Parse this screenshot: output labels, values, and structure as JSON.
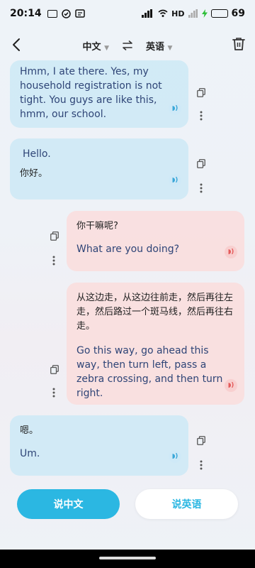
{
  "status_bar": {
    "time": "20:14",
    "right_text": "HD",
    "battery": "69",
    "battery_level": 0.69
  },
  "header": {
    "source_lang": "中文",
    "target_lang": "英语"
  },
  "messages": [
    {
      "side": "left",
      "en": "Hmm, I ate there. Yes, my household registration is not tight. You guys are like this, hmm, our school."
    },
    {
      "side": "left",
      "en": "Hello.",
      "zh": "你好。"
    },
    {
      "side": "right",
      "zh": "你干嘛呢?",
      "en": "What are you doing?"
    },
    {
      "side": "right",
      "zh": "从这边走，从这边往前走，然后再往左走，然后路过一个斑马线，然后再往右走。",
      "en": "Go this way, go ahead this way, then turn left, pass a zebra crossing, and then turn right."
    },
    {
      "side": "left",
      "zh": "嗯。",
      "en": "Um."
    }
  ],
  "buttons": {
    "speak_chinese": "说中文",
    "speak_english": "说英语"
  },
  "icons": {
    "back": "chevron-left-icon",
    "delete": "trash-icon",
    "swap": "swap-icon",
    "copy": "copy-icon",
    "more": "more-vertical-icon",
    "speaker": "speaker-icon"
  },
  "colors": {
    "accent": "#2bb7e2",
    "left_bubble": "#cde9f6",
    "right_bubble": "#fadede"
  }
}
